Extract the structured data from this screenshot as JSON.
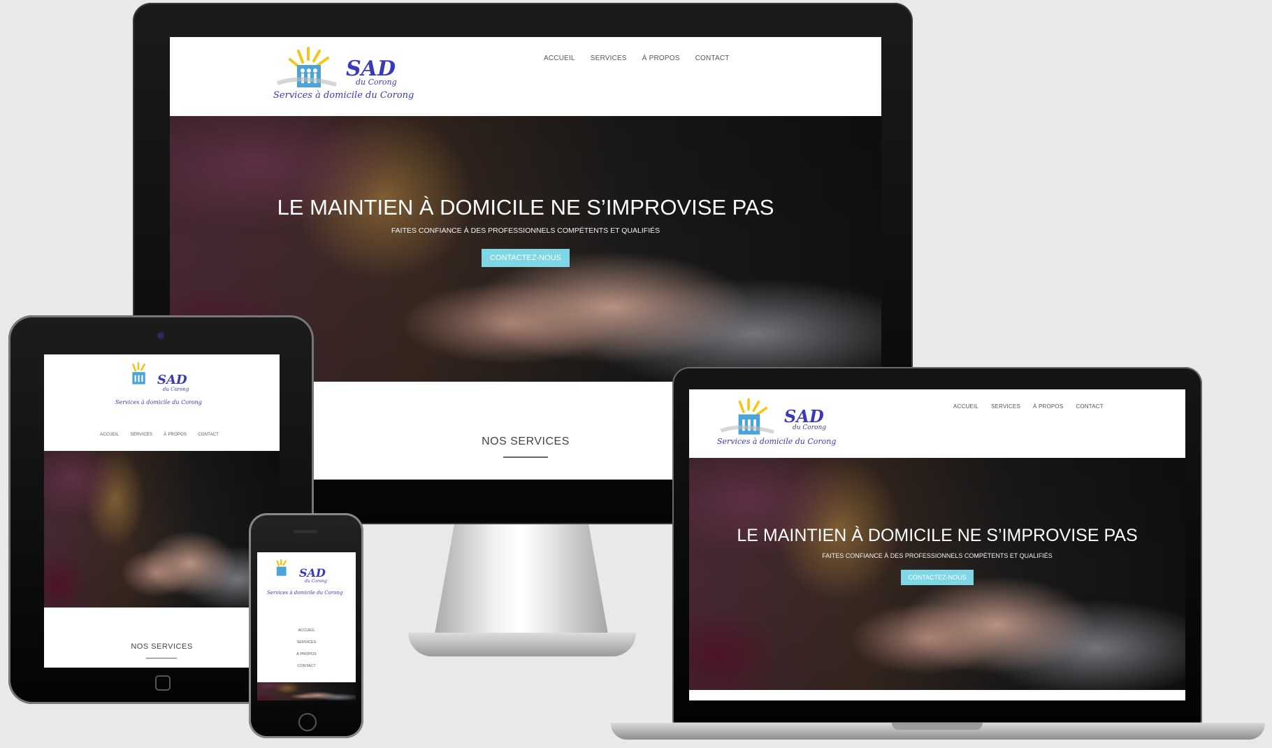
{
  "logo": {
    "title": "SAD",
    "subtitle": "du Corong",
    "tagline": "Services à domicile du Corong"
  },
  "nav": {
    "items": [
      {
        "label": "ACCUEIL"
      },
      {
        "label": "SERVICES"
      },
      {
        "label": "À PROPOS"
      },
      {
        "label": "CONTACT"
      }
    ]
  },
  "hero": {
    "title": "LE MAINTIEN À DOMICILE NE S’IMPROVISE PAS",
    "subtitle": "FAITES CONFIANCE À DES PROFESSIONNELS COMPÉTENTS ET QUALIFIÉS",
    "cta_label": "CONTACTEZ-NOUS"
  },
  "section": {
    "title": "NOS SERVICES"
  },
  "colors": {
    "accent": "#7fd6e4",
    "logo_blue": "#3a3ab8",
    "logo_yellow": "#f5c518",
    "background": "#e9e9e9"
  }
}
